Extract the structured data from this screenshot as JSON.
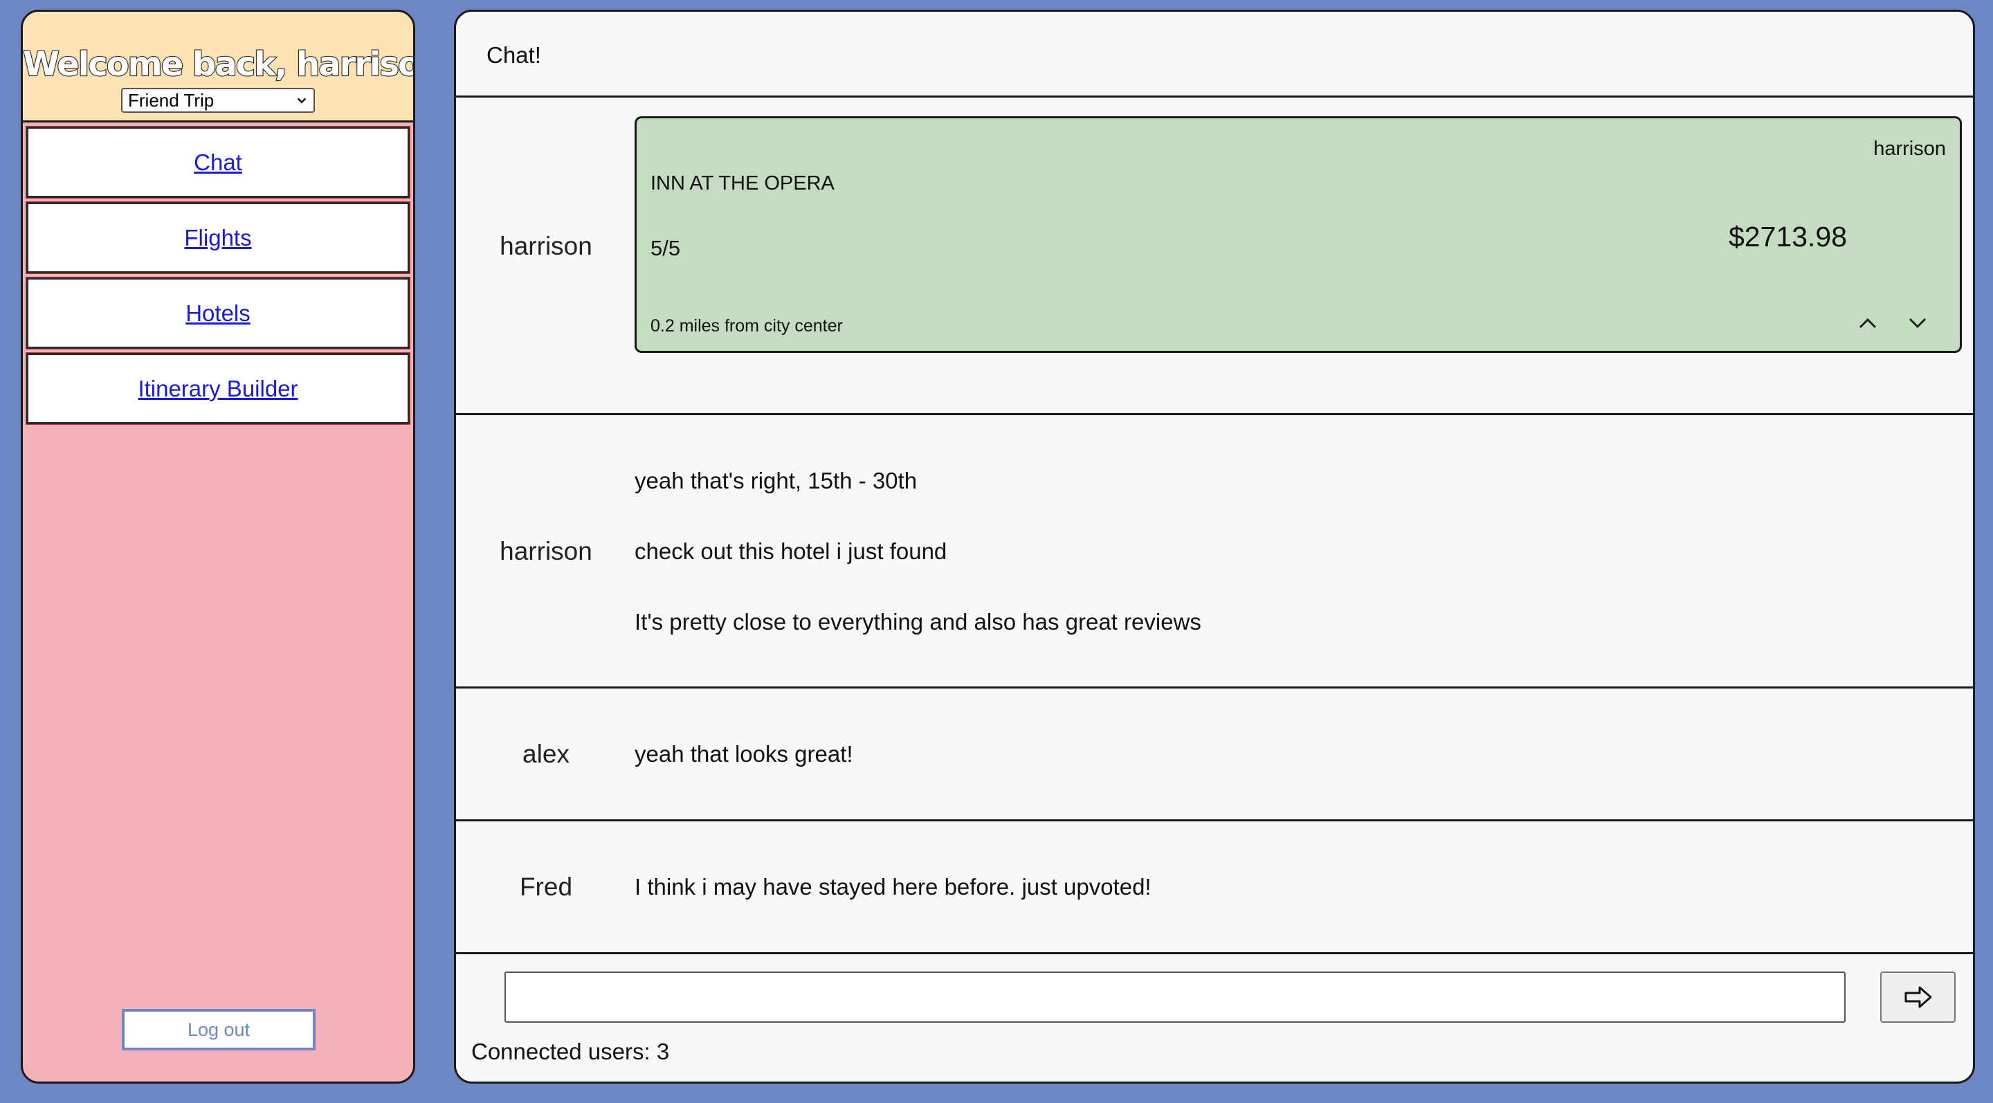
{
  "sidebar": {
    "welcome": "Welcome back, harrison!",
    "trip_selected": "Friend Trip",
    "nav": [
      "Chat",
      "Flights",
      "Hotels",
      "Itinerary Builder"
    ],
    "logout_label": "Log out"
  },
  "main": {
    "title": "Chat!",
    "hotel_message": {
      "sender": "harrison",
      "poster": "harrison",
      "hotel_name": "INN AT THE OPERA",
      "rating": "5/5",
      "price": "$2713.98",
      "distance": "0.2 miles from city center"
    },
    "messages": [
      {
        "sender": "harrison",
        "lines": [
          "yeah that's right, 15th - 30th",
          "check out this hotel i just found",
          "It's pretty close to everything and also has great reviews"
        ]
      },
      {
        "sender": "alex",
        "lines": [
          "yeah that looks great!"
        ]
      },
      {
        "sender": "Fred",
        "lines": [
          "I think i may have stayed here before. just upvoted!"
        ]
      }
    ],
    "composer": {
      "input_value": "",
      "connected_users": "Connected users: 3"
    }
  },
  "colors": {
    "background": "#6d87c4",
    "sidebar": "#f3b1b9",
    "sidebar_header": "#fde2b3",
    "hotel_card": "#c4dcc0",
    "link": "#1a1adc"
  },
  "icons": {
    "select_arrow": "chevron-down-icon",
    "upvote": "chevron-up-icon",
    "downvote": "chevron-down-icon",
    "send": "arrow-right-icon"
  }
}
